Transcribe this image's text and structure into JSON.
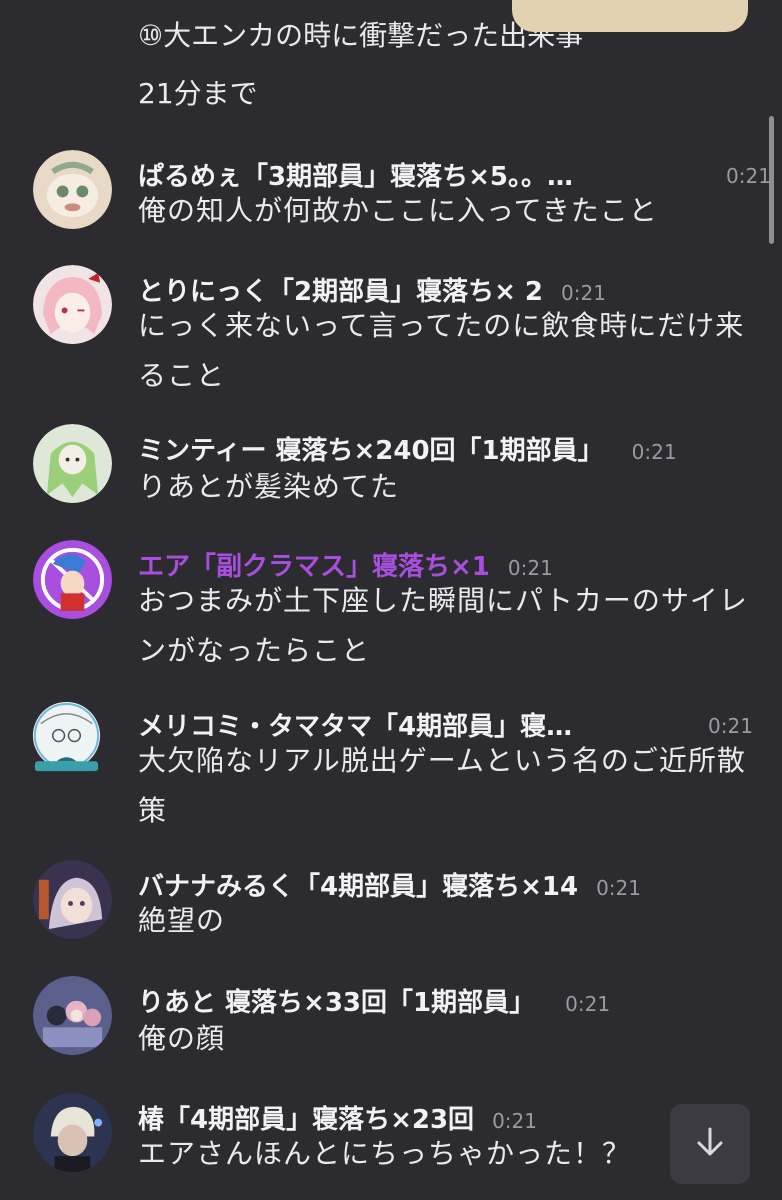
{
  "top_message": {
    "cut_line": "⑩大エンカの時に衝撃だった出来事",
    "sub_line": "21分まで"
  },
  "messages": [
    {
      "name": "ぱるめぇ「3期部員」寝落ち×5。。…",
      "time": "0:21",
      "text": "俺の知人が何故かここに入ってきたこと",
      "avatar_color": "#e8d9c7"
    },
    {
      "name": "とりにっく「2期部員」寝落ち× 2",
      "time": "0:21",
      "text": "にっく来ないって言ってたのに飲食時にだけ来ること",
      "avatar_color": "#f1e4e6"
    },
    {
      "name": "ミンティー 寝落ち×240回「1期部員」",
      "time": "0:21",
      "text": "りあとが髪染めてた",
      "avatar_color": "#dfe8d8"
    },
    {
      "name": "エア「副クラマス」寝落ち×1",
      "time": "0:21",
      "text": "おつまみが土下座した瞬間にパトカーのサイレンがなったらこと",
      "avatar_color": "#a94fe0",
      "name_color": "#a94fe0"
    },
    {
      "name": "メリコミ・タマタマ「4期部員」寝…",
      "time": "0:21",
      "text": "大欠陥なリアル脱出ゲームという名のご近所散策",
      "avatar_color": "#eef3f6"
    },
    {
      "name": "バナナみるく「4期部員」寝落ち×14",
      "time": "0:21",
      "text": "絶望の",
      "avatar_color": "#3a3350"
    },
    {
      "name": "りあと 寝落ち×33回「1期部員」",
      "time": "0:21",
      "text": "俺の顔",
      "avatar_color": "#5a5f8c"
    },
    {
      "name": "椿「4期部員」寝落ち×23回",
      "time": "0:21",
      "text": "エアさんほんとにちっちゃかった！？",
      "avatar_color": "#2d3450"
    }
  ],
  "colors": {
    "background": "#2b2b30",
    "text": "#e9e9ee",
    "time": "#9a9aa2",
    "highlight_name": "#a94fe0",
    "overlay_card": "#e3d2b1"
  },
  "icons": {
    "scroll_down": "arrow-down-icon"
  }
}
